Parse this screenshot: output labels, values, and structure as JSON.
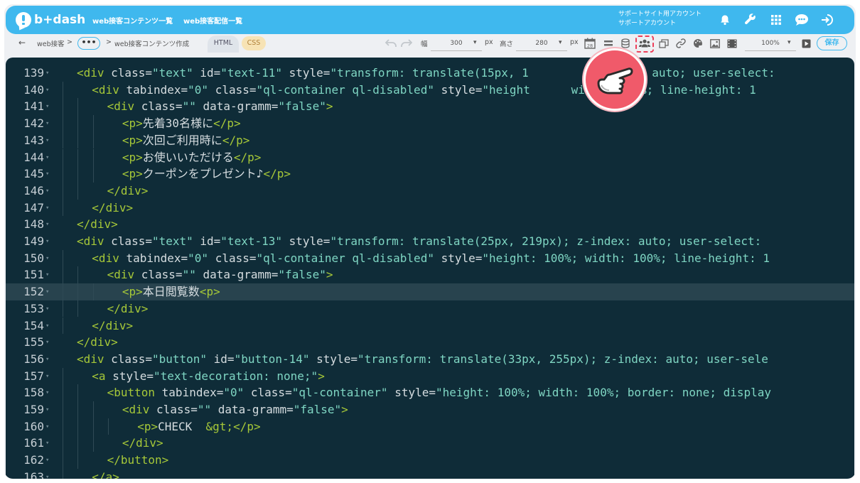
{
  "header": {
    "logo_text": "b+dash",
    "nav": [
      "web接客コンテンツ一覧",
      "web接客配信一覧"
    ],
    "account_line1": "サポートサイト用アカウント",
    "account_line2": "サポートアカウント",
    "icons": [
      "bell-icon",
      "wrench-icon",
      "grid-icon",
      "chat-icon",
      "logout-icon"
    ]
  },
  "toolbar": {
    "back_arrow": "←",
    "breadcrumb_root": "web接客",
    "sep": ">",
    "ellipsis": "•••",
    "breadcrumb_current": "web接客コンテンツ作成",
    "tab_html": "HTML",
    "tab_css": "CSS",
    "width_label": "幅",
    "width_value": "300",
    "px1": "px",
    "height_label": "高さ",
    "height_value": "280",
    "px2": "px",
    "calendar_day": "28",
    "zoom_value": "100%",
    "save_label": "保存"
  },
  "editor": {
    "active_line": "152",
    "lines": [
      {
        "n": "139",
        "indent": 1,
        "parts": [
          [
            "tag",
            "<div"
          ],
          [
            "attr",
            " class="
          ],
          [
            "val",
            "\"text\""
          ],
          [
            "attr",
            " id="
          ],
          [
            "val",
            "\"text-11\""
          ],
          [
            "attr",
            " style="
          ],
          [
            "val",
            "\"transform: translate(15px, 1"
          ],
          [
            "val",
            "         z-index: auto; user-select: "
          ]
        ]
      },
      {
        "n": "140",
        "indent": 2,
        "parts": [
          [
            "tag",
            "<div"
          ],
          [
            "attr",
            " tabindex="
          ],
          [
            "val",
            "\"0\""
          ],
          [
            "attr",
            " class="
          ],
          [
            "val",
            "\"ql-container ql-disabled\""
          ],
          [
            "attr",
            " style="
          ],
          [
            "val",
            "\"height"
          ],
          [
            "val",
            "      width: 100%; line-height: 1"
          ]
        ]
      },
      {
        "n": "141",
        "indent": 3,
        "parts": [
          [
            "tag",
            "<div"
          ],
          [
            "attr",
            " class="
          ],
          [
            "val",
            "\"\""
          ],
          [
            "attr",
            " data-gramm="
          ],
          [
            "val",
            "\"false\""
          ],
          [
            "tag",
            ">"
          ]
        ]
      },
      {
        "n": "142",
        "indent": 4,
        "parts": [
          [
            "tag",
            "<p>"
          ],
          [
            "txt",
            "先着30名様に"
          ],
          [
            "tag",
            "</p>"
          ]
        ]
      },
      {
        "n": "143",
        "indent": 4,
        "parts": [
          [
            "tag",
            "<p>"
          ],
          [
            "txt",
            "次回ご利用時に"
          ],
          [
            "tag",
            "</p>"
          ]
        ]
      },
      {
        "n": "144",
        "indent": 4,
        "parts": [
          [
            "tag",
            "<p>"
          ],
          [
            "txt",
            "お使いいただける"
          ],
          [
            "tag",
            "</p>"
          ]
        ]
      },
      {
        "n": "145",
        "indent": 4,
        "parts": [
          [
            "tag",
            "<p>"
          ],
          [
            "txt",
            "クーポンをプレゼント♪"
          ],
          [
            "tag",
            "</p>"
          ]
        ]
      },
      {
        "n": "146",
        "indent": 3,
        "parts": [
          [
            "tag",
            "</div>"
          ]
        ]
      },
      {
        "n": "147",
        "indent": 2,
        "parts": [
          [
            "tag",
            "</div>"
          ]
        ]
      },
      {
        "n": "148",
        "indent": 1,
        "parts": [
          [
            "tag",
            "</div>"
          ]
        ]
      },
      {
        "n": "149",
        "indent": 1,
        "parts": [
          [
            "tag",
            "<div"
          ],
          [
            "attr",
            " class="
          ],
          [
            "val",
            "\"text\""
          ],
          [
            "attr",
            " id="
          ],
          [
            "val",
            "\"text-13\""
          ],
          [
            "attr",
            " style="
          ],
          [
            "val",
            "\"transform: translate(25px, 219px); z-index: auto; user-select: "
          ]
        ]
      },
      {
        "n": "150",
        "indent": 2,
        "parts": [
          [
            "tag",
            "<div"
          ],
          [
            "attr",
            " tabindex="
          ],
          [
            "val",
            "\"0\""
          ],
          [
            "attr",
            " class="
          ],
          [
            "val",
            "\"ql-container ql-disabled\""
          ],
          [
            "attr",
            " style="
          ],
          [
            "val",
            "\"height: 100%; width: 100%; line-height: 1"
          ]
        ]
      },
      {
        "n": "151",
        "indent": 3,
        "parts": [
          [
            "tag",
            "<div"
          ],
          [
            "attr",
            " class="
          ],
          [
            "val",
            "\"\""
          ],
          [
            "attr",
            " data-gramm="
          ],
          [
            "val",
            "\"false\""
          ],
          [
            "tag",
            ">"
          ]
        ]
      },
      {
        "n": "152",
        "indent": 4,
        "parts": [
          [
            "tag",
            "<p>"
          ],
          [
            "txt",
            "本日閲覧数"
          ],
          [
            "tag",
            "<p>"
          ]
        ]
      },
      {
        "n": "153",
        "indent": 3,
        "parts": [
          [
            "tag",
            "</div>"
          ]
        ]
      },
      {
        "n": "154",
        "indent": 2,
        "parts": [
          [
            "tag",
            "</div>"
          ]
        ]
      },
      {
        "n": "155",
        "indent": 1,
        "parts": [
          [
            "tag",
            "</div>"
          ]
        ]
      },
      {
        "n": "156",
        "indent": 1,
        "parts": [
          [
            "tag",
            "<div"
          ],
          [
            "attr",
            " class="
          ],
          [
            "val",
            "\"button\""
          ],
          [
            "attr",
            " id="
          ],
          [
            "val",
            "\"button-14\""
          ],
          [
            "attr",
            " style="
          ],
          [
            "val",
            "\"transform: translate(33px, 255px); z-index: auto; user-sele"
          ]
        ]
      },
      {
        "n": "157",
        "indent": 2,
        "parts": [
          [
            "tag",
            "<a"
          ],
          [
            "attr",
            " style="
          ],
          [
            "val",
            "\"text-decoration: none;\""
          ],
          [
            "tag",
            ">"
          ]
        ]
      },
      {
        "n": "158",
        "indent": 3,
        "parts": [
          [
            "tag",
            "<button"
          ],
          [
            "attr",
            " tabindex="
          ],
          [
            "val",
            "\"0\""
          ],
          [
            "attr",
            " class="
          ],
          [
            "val",
            "\"ql-container\""
          ],
          [
            "attr",
            " style="
          ],
          [
            "val",
            "\"height: 100%; width: 100%; border: none; display"
          ]
        ]
      },
      {
        "n": "159",
        "indent": 4,
        "parts": [
          [
            "tag",
            "<div"
          ],
          [
            "attr",
            " class="
          ],
          [
            "val",
            "\"\""
          ],
          [
            "attr",
            " data-gramm="
          ],
          [
            "val",
            "\"false\""
          ],
          [
            "tag",
            ">"
          ]
        ]
      },
      {
        "n": "160",
        "indent": 5,
        "parts": [
          [
            "tag",
            "<p>"
          ],
          [
            "txt",
            "CHECK  "
          ],
          [
            "tag",
            "&gt;</p>"
          ]
        ]
      },
      {
        "n": "161",
        "indent": 4,
        "parts": [
          [
            "tag",
            "</div>"
          ]
        ]
      },
      {
        "n": "162",
        "indent": 3,
        "parts": [
          [
            "tag",
            "</button>"
          ]
        ]
      },
      {
        "n": "163",
        "indent": 2,
        "parts": [
          [
            "tag",
            "</a>"
          ]
        ]
      }
    ]
  },
  "colors": {
    "brand": "#3fb8ee",
    "editor_bg": "#0f2c38",
    "tag": "#a6c838",
    "string": "#7fd6c3",
    "pointer": "#f05a6a"
  }
}
